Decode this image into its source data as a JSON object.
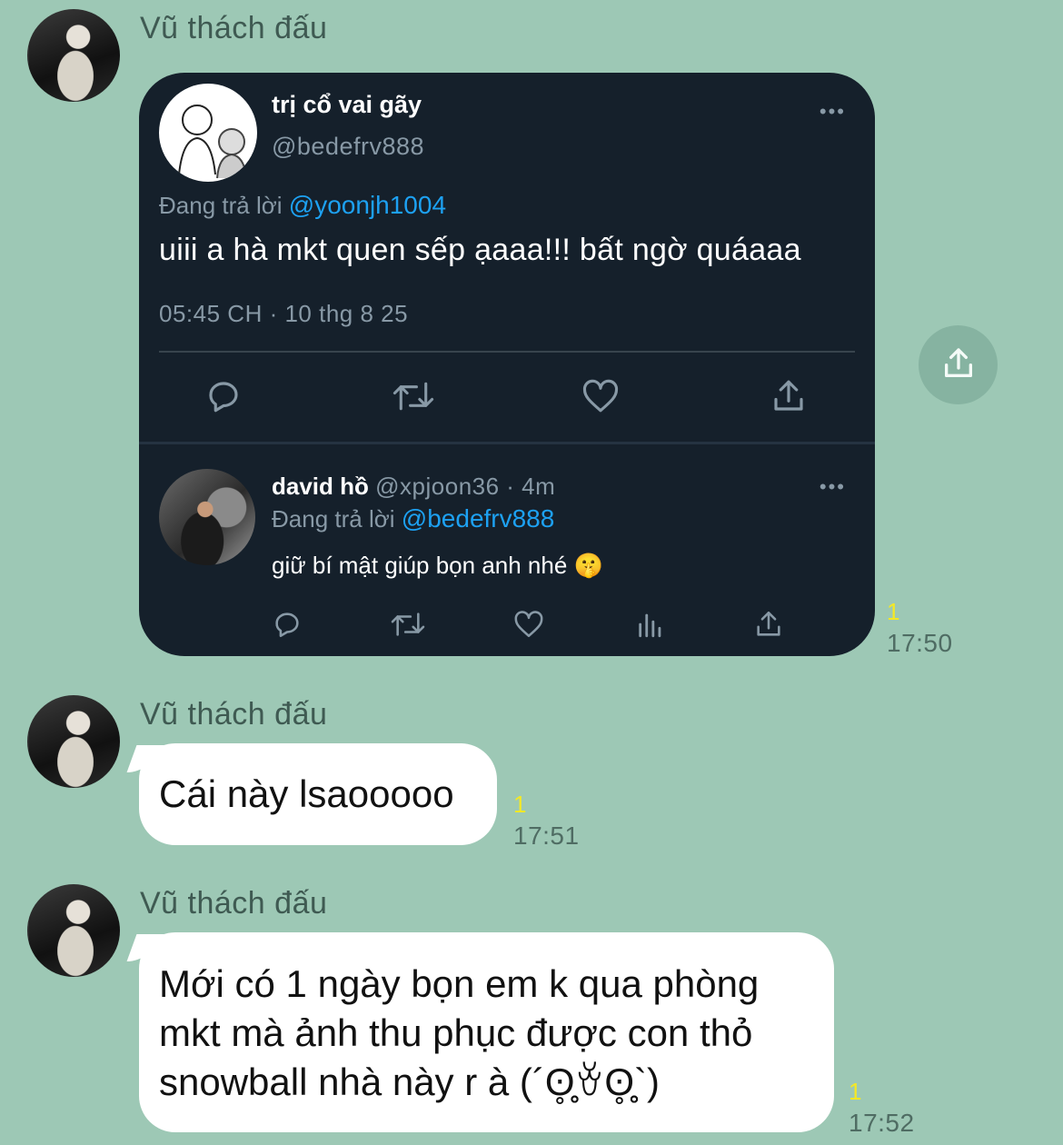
{
  "messages": [
    {
      "sender": "Vũ thách đấu",
      "tweet": {
        "author_name": "trị cổ vai gãy",
        "author_handle": "@bedefrv888",
        "more": "•••",
        "replying_prefix": "Đang trả lời",
        "replying_to": "@yoonjh1004",
        "text": "uiii a hà mkt quen sếp ạaaa!!! bất ngờ quáaaa",
        "timestamp": "05:45 CH · 10 thg 8 25",
        "reply": {
          "author_name": "david hồ",
          "meta": "@xpjoon36 · 4m",
          "more": "•••",
          "replying_prefix": "Đang trả lời",
          "replying_to": "@bedefrv888",
          "text": "giữ bí mật giúp bọn anh nhé 🤫"
        }
      },
      "read_count": "1",
      "time": "17:50"
    },
    {
      "sender": "Vũ thách đấu",
      "text": "Cái này lsaooooo",
      "read_count": "1",
      "time": "17:51"
    },
    {
      "sender": "Vũ thách đấu",
      "text_lines": [
        "Mới có 1 ngày bọn em k qua phòng",
        "mkt mà ảnh thu phục được con thỏ",
        "snowball nhà này r à (´ʘ̥̥̥̥̥̥ꈊʘ̥̥̥̥̥̥`)"
      ],
      "read_count": "1",
      "time": "17:52"
    }
  ],
  "icons": {
    "reply": "reply-icon",
    "retweet": "retweet-icon",
    "like": "heart-icon",
    "share": "share-icon",
    "analytics": "analytics-icon"
  },
  "colors": {
    "background": "#9dc8b5",
    "tweet_bg": "#15202b",
    "link": "#1da1f2",
    "read_count": "#f4e826"
  }
}
